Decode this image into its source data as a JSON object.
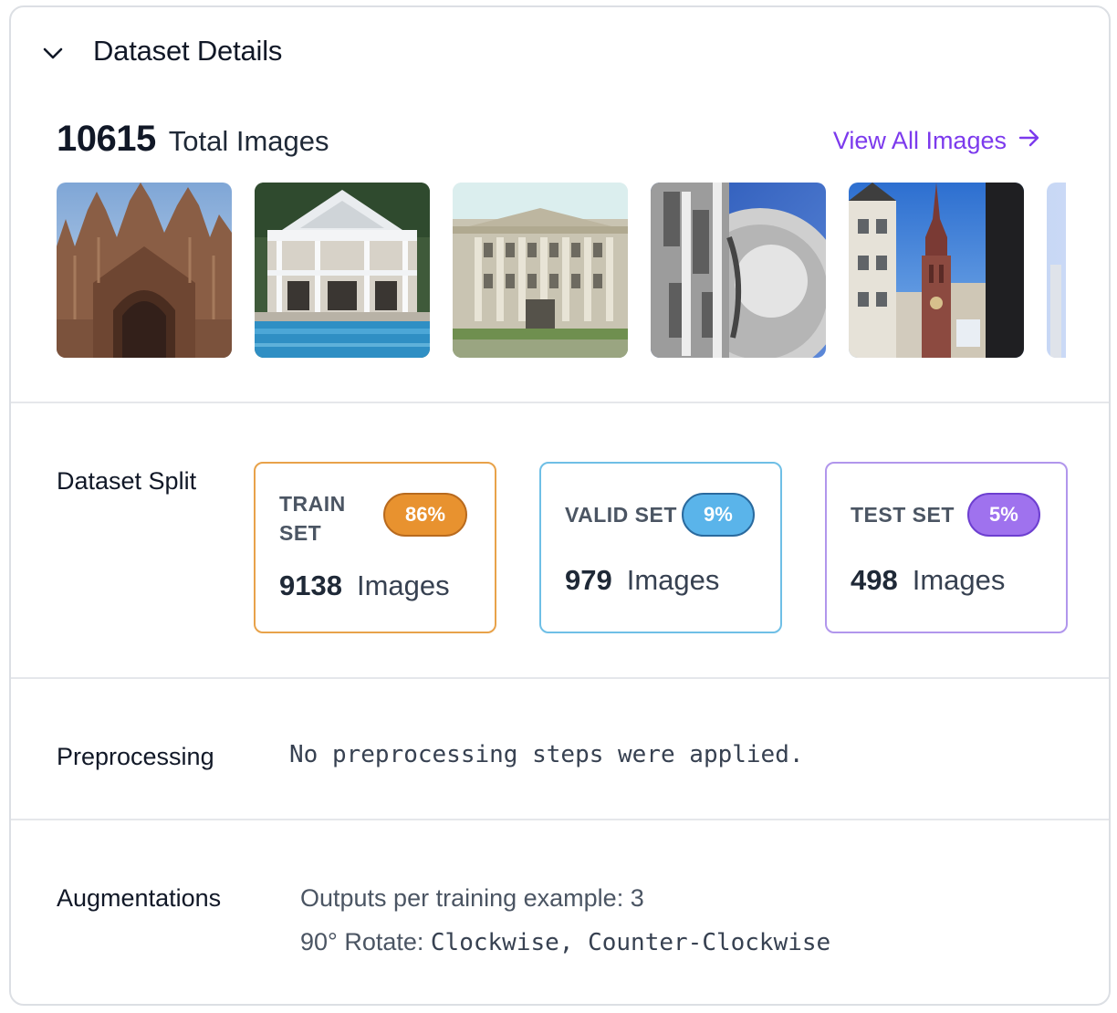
{
  "header": {
    "title": "Dataset Details",
    "toggle_icon": "chevron-down-icon"
  },
  "summary": {
    "total_count": "10615",
    "total_label": "Total Images",
    "view_all_label": "View All Images",
    "view_all_icon": "arrow-right-icon"
  },
  "thumbnails": [
    {
      "name": "gothic-cathedral-facade"
    },
    {
      "name": "colonial-house-with-pool"
    },
    {
      "name": "vintage-postcard-building"
    },
    {
      "name": "close-up-ornate-dome"
    },
    {
      "name": "cathedral-tower-street"
    },
    {
      "name": "partial-thumbnail"
    }
  ],
  "split": {
    "label": "Dataset Split",
    "train": {
      "name": "TRAIN SET",
      "percent": "86%",
      "count": "9138",
      "unit": "Images",
      "color": "#e8922f"
    },
    "valid": {
      "name": "VALID SET",
      "percent": "9%",
      "count": "979",
      "unit": "Images",
      "color": "#5ab4ea"
    },
    "test": {
      "name": "TEST SET",
      "percent": "5%",
      "count": "498",
      "unit": "Images",
      "color": "#9f72ee"
    }
  },
  "preprocessing": {
    "label": "Preprocessing",
    "text": "No preprocessing steps were applied."
  },
  "augmentations": {
    "label": "Augmentations",
    "outputs_text": "Outputs per training example: 3",
    "rotate_key": "90° Rotate:",
    "rotate_value": "Clockwise, Counter-Clockwise"
  },
  "colors": {
    "accent": "#7c3aed",
    "border": "#dcdfe4",
    "divider": "#e5e7eb"
  }
}
